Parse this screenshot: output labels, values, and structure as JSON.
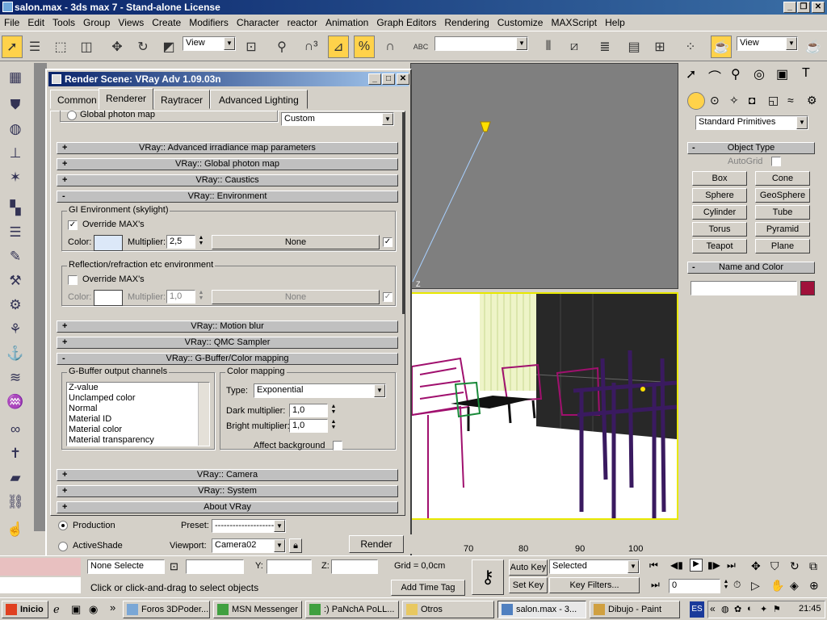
{
  "app": {
    "title": "salon.max - 3ds max 7 - Stand-alone License"
  },
  "menu": [
    "File",
    "Edit",
    "Tools",
    "Group",
    "Views",
    "Create",
    "Modifiers",
    "Character",
    "reactor",
    "Animation",
    "Graph Editors",
    "Rendering",
    "Customize",
    "MAXScript",
    "Help"
  ],
  "toolbar": {
    "view_combo": "View",
    "view_combo2": "View",
    "abc_label": "ABC"
  },
  "dialog": {
    "title": "Render Scene: VRay Adv 1.09.03n",
    "tabs": [
      "Common",
      "Renderer",
      "Raytracer",
      "Advanced Lighting"
    ],
    "active_tab": "Renderer",
    "global_photon_map_label": "Global photon map",
    "custom_combo": "Custom",
    "rollouts": {
      "adv_irradiance": "VRay:: Advanced irradiance map parameters",
      "global_photon": "VRay:: Global photon map",
      "caustics": "VRay:: Caustics",
      "environment": "VRay:: Environment",
      "motion_blur": "VRay:: Motion blur",
      "qmc": "VRay:: QMC Sampler",
      "gbuffer": "VRay:: G-Buffer/Color mapping",
      "camera": "VRay:: Camera",
      "system": "VRay:: System",
      "about": "About VRay"
    },
    "gi_env": {
      "group": "GI Environment (skylight)",
      "override": "Override MAX's",
      "override_checked": true,
      "color_label": "Color:",
      "color": "#dce8f8",
      "multiplier_label": "Multiplier:",
      "multiplier": "2,5",
      "map": "None",
      "map_checked": true
    },
    "refl_env": {
      "group": "Reflection/refraction etc environment",
      "override": "Override MAX's",
      "override_checked": false,
      "color_label": "Color:",
      "color": "#ffffff",
      "multiplier_label": "Multiplier:",
      "multiplier": "1,0",
      "map": "None"
    },
    "gbuffer": {
      "group": "G-Buffer output channels",
      "channels": [
        "Z-value",
        "Unclamped color",
        "Normal",
        "Material ID",
        "Material color",
        "Material transparency"
      ]
    },
    "color_mapping": {
      "group": "Color mapping",
      "type_label": "Type:",
      "type": "Exponential",
      "dark_label": "Dark multiplier:",
      "dark": "1,0",
      "bright_label": "Bright multiplier:",
      "bright": "1,0",
      "affect_bg": "Affect background"
    },
    "bottom": {
      "production": "Production",
      "activeshade": "ActiveShade",
      "preset_label": "Preset:",
      "preset": "--------------------",
      "viewport_label": "Viewport:",
      "viewport": "Camera02",
      "render": "Render"
    }
  },
  "command_panel": {
    "category": "Standard Primitives",
    "object_type": "Object Type",
    "autogrid": "AutoGrid",
    "buttons": [
      "Box",
      "Cone",
      "Sphere",
      "GeoSphere",
      "Cylinder",
      "Tube",
      "Torus",
      "Pyramid",
      "Teapot",
      "Plane"
    ],
    "name_and_color": "Name and Color",
    "object_color": "#a0103a"
  },
  "status": {
    "none_selected": "None Selecte",
    "y_label": "Y:",
    "z_label": "Z:",
    "grid": "Grid = 0,0cm",
    "prompt": "Click or click-and-drag to select objects",
    "add_time_tag": "Add Time Tag",
    "auto_key": "Auto Key",
    "set_key": "Set Key",
    "selected": "Selected",
    "key_filters": "Key Filters...",
    "frame": "0",
    "timeline": [
      "70",
      "80",
      "90",
      "100"
    ]
  },
  "taskbar": {
    "start": "Inicio",
    "items": [
      "Foros 3DPoder...",
      "MSN Messenger",
      ":) PaNchA PoLL...",
      "Otros",
      "salon.max - 3...",
      "Dibujo - Paint"
    ],
    "active_index": 4,
    "lang": "ES",
    "clock": "21:45"
  }
}
